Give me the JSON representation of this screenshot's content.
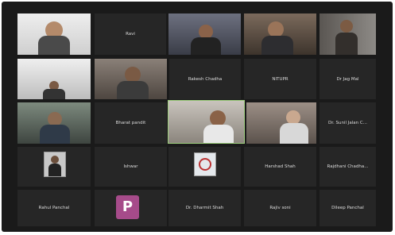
{
  "participants": [
    {
      "id": "p1",
      "name": "",
      "caption": "",
      "kind": "video",
      "active": false
    },
    {
      "id": "p2",
      "name": "Ravi",
      "caption": "",
      "kind": "name",
      "active": false
    },
    {
      "id": "p3",
      "name": "",
      "caption": "",
      "kind": "video",
      "active": false
    },
    {
      "id": "p4",
      "name": "",
      "caption": "",
      "kind": "video",
      "active": false
    },
    {
      "id": "p5",
      "name": "",
      "caption": "",
      "kind": "video",
      "active": false
    },
    {
      "id": "p6",
      "name": "",
      "caption": "",
      "kind": "video",
      "active": false
    },
    {
      "id": "p7",
      "name": "",
      "caption": "",
      "kind": "video",
      "active": false
    },
    {
      "id": "p8",
      "name": "Rakesh Chadha",
      "caption": "",
      "kind": "name",
      "active": false
    },
    {
      "id": "p9",
      "name": "NITUPR",
      "caption": "",
      "kind": "name",
      "active": false
    },
    {
      "id": "p10",
      "name": "Dr Jag Mal",
      "caption": "",
      "kind": "name",
      "active": false
    },
    {
      "id": "p11",
      "name": "",
      "caption": "",
      "kind": "video",
      "active": false
    },
    {
      "id": "p12",
      "name": "Bharat pandit",
      "caption": "",
      "kind": "name",
      "active": false
    },
    {
      "id": "p13",
      "name": "",
      "caption": "",
      "kind": "video",
      "active": true
    },
    {
      "id": "p14",
      "name": "",
      "caption": "",
      "kind": "video",
      "active": false
    },
    {
      "id": "p15",
      "name": "Dr. Sunil Jalan C...",
      "caption": "",
      "kind": "name",
      "active": false
    },
    {
      "id": "p16",
      "name": "",
      "caption": "",
      "kind": "photo",
      "active": false
    },
    {
      "id": "p17",
      "name": "Ishwar",
      "caption": "",
      "kind": "name",
      "active": false
    },
    {
      "id": "p18",
      "name": "",
      "caption": "",
      "kind": "photo",
      "active": false
    },
    {
      "id": "p19",
      "name": "Harshad Shah",
      "caption": "",
      "kind": "name",
      "active": false
    },
    {
      "id": "p20",
      "name": "Rajdhani Chadha...",
      "caption": "",
      "kind": "name",
      "active": false
    },
    {
      "id": "p21",
      "name": "Rahul Panchal",
      "caption": "",
      "kind": "name",
      "active": false
    },
    {
      "id": "p22",
      "name": "",
      "caption": "",
      "kind": "avatar",
      "avatar_letter": "P",
      "active": false
    },
    {
      "id": "p23",
      "name": "Dr. Dharmit Shah",
      "caption": "",
      "kind": "name",
      "active": false
    },
    {
      "id": "p24",
      "name": "Rajiv soni",
      "caption": "",
      "kind": "name",
      "active": false
    },
    {
      "id": "p25",
      "name": "Dileep Panchal",
      "caption": "",
      "kind": "name",
      "active": false
    }
  ]
}
